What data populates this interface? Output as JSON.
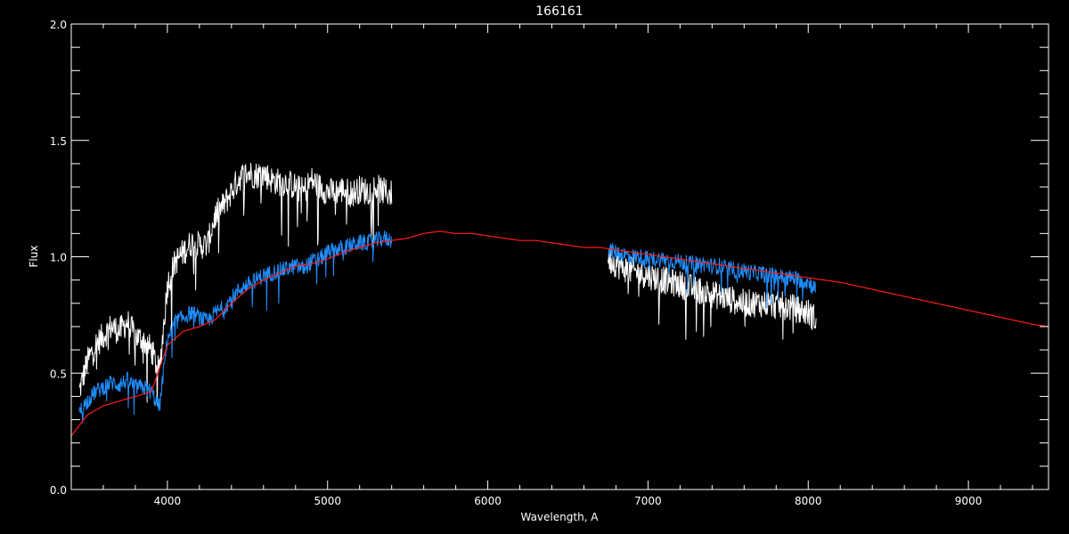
{
  "chart_data": {
    "type": "line",
    "title": "166161",
    "xlabel": "Wavelength, A",
    "ylabel": "Flux",
    "xlim": [
      3400,
      9500
    ],
    "ylim": [
      0.0,
      2.0
    ],
    "x_ticks": [
      4000,
      5000,
      6000,
      7000,
      8000,
      9000
    ],
    "x_tick_labels": [
      "4000",
      "5000",
      "6000",
      "7000",
      "8000",
      "9000"
    ],
    "y_ticks": [
      0.0,
      0.5,
      1.0,
      1.5,
      2.0
    ],
    "y_tick_labels": [
      "0.0",
      "0.5",
      "1.0",
      "1.5",
      "2.0"
    ],
    "grid": false,
    "background": "#000000",
    "series": [
      {
        "color": "#ffffff",
        "noise": 0.06,
        "segments": [
          {
            "x": [
              3450,
              3500,
              3550,
              3600,
              3650,
              3700,
              3750,
              3800,
              3850,
              3900,
              3950,
              4000,
              4050,
              4100,
              4150,
              4200,
              4250,
              4300,
              4350,
              4400,
              4450,
              4500,
              4550,
              4600,
              4650,
              4700,
              4750,
              4800,
              4850,
              4900,
              4950,
              5000,
              5050,
              5100,
              5150,
              5200,
              5250,
              5300,
              5350,
              5400
            ],
            "y": [
              0.42,
              0.55,
              0.62,
              0.66,
              0.7,
              0.68,
              0.72,
              0.66,
              0.64,
              0.6,
              0.5,
              0.88,
              0.98,
              1.02,
              1.06,
              1.05,
              1.05,
              1.18,
              1.22,
              1.28,
              1.34,
              1.36,
              1.35,
              1.36,
              1.33,
              1.32,
              1.32,
              1.3,
              1.28,
              1.33,
              1.3,
              1.28,
              1.28,
              1.29,
              1.27,
              1.29,
              1.28,
              1.3,
              1.28,
              1.27
            ]
          },
          {
            "x": [
              6750,
              6800,
              6850,
              6900,
              6950,
              7000,
              7050,
              7100,
              7150,
              7200,
              7250,
              7300,
              7350,
              7400,
              7450,
              7500,
              7550,
              7600,
              7650,
              7700,
              7750,
              7800,
              7850,
              7900,
              7950,
              8000,
              8050
            ],
            "y": [
              0.99,
              0.97,
              0.95,
              0.94,
              0.93,
              0.92,
              0.91,
              0.9,
              0.89,
              0.88,
              0.87,
              0.86,
              0.85,
              0.84,
              0.83,
              0.82,
              0.81,
              0.8,
              0.8,
              0.8,
              0.8,
              0.79,
              0.79,
              0.78,
              0.77,
              0.76,
              0.73
            ]
          }
        ]
      },
      {
        "color": "#1e8fff",
        "noise": 0.035,
        "segments": [
          {
            "x": [
              3450,
              3500,
              3550,
              3600,
              3650,
              3700,
              3750,
              3800,
              3850,
              3900,
              3950,
              4000,
              4050,
              4100,
              4150,
              4200,
              4250,
              4300,
              4350,
              4400,
              4450,
              4500,
              4550,
              4600,
              4650,
              4700,
              4750,
              4800,
              4850,
              4900,
              4950,
              5000,
              5050,
              5100,
              5150,
              5200,
              5250,
              5300,
              5350,
              5400
            ],
            "y": [
              0.33,
              0.38,
              0.42,
              0.44,
              0.46,
              0.45,
              0.47,
              0.44,
              0.44,
              0.42,
              0.35,
              0.65,
              0.72,
              0.74,
              0.76,
              0.74,
              0.72,
              0.76,
              0.78,
              0.82,
              0.86,
              0.88,
              0.9,
              0.92,
              0.93,
              0.94,
              0.95,
              0.96,
              0.95,
              0.98,
              0.99,
              1.02,
              1.03,
              1.04,
              1.05,
              1.06,
              1.06,
              1.07,
              1.08,
              1.07
            ]
          },
          {
            "x": [
              6750,
              6800,
              6850,
              6900,
              6950,
              7000,
              7050,
              7100,
              7150,
              7200,
              7250,
              7300,
              7350,
              7400,
              7450,
              7500,
              7550,
              7600,
              7650,
              7700,
              7750,
              7800,
              7850,
              7900,
              7950,
              8000,
              8050
            ],
            "y": [
              1.03,
              1.02,
              1.01,
              1.0,
              1.0,
              0.99,
              0.99,
              0.99,
              0.98,
              0.98,
              0.97,
              0.97,
              0.97,
              0.96,
              0.96,
              0.95,
              0.94,
              0.94,
              0.93,
              0.93,
              0.92,
              0.92,
              0.91,
              0.91,
              0.9,
              0.89,
              0.86
            ]
          },
          {
            "x": [
              3450,
              4000,
              4500,
              5000,
              5400
            ],
            "y": [
              0.0,
              0.0,
              0.0,
              0.0,
              0.0
            ]
          },
          {
            "x": [
              6750,
              7000,
              7500,
              8000,
              8050
            ],
            "y": [
              0.0,
              0.0,
              0.0,
              0.0,
              0.0
            ]
          }
        ]
      },
      {
        "color": "#ff1a1a",
        "noise": 0.0,
        "segments": [
          {
            "x": [
              3400,
              3500,
              3600,
              3700,
              3800,
              3900,
              4000,
              4100,
              4200,
              4300,
              4400,
              4500,
              4600,
              4700,
              4800,
              4900,
              5000,
              5100,
              5200,
              5300,
              5400,
              5500,
              5600,
              5700,
              5800,
              5900,
              6000,
              6100,
              6200,
              6300,
              6400,
              6500,
              6600,
              6700,
              6800,
              6900,
              7000,
              7200,
              7400,
              7600,
              7800,
              8000,
              8200,
              8400,
              8600,
              8800,
              9000,
              9200,
              9400,
              9500
            ],
            "y": [
              0.23,
              0.32,
              0.36,
              0.38,
              0.4,
              0.42,
              0.62,
              0.68,
              0.7,
              0.73,
              0.8,
              0.86,
              0.9,
              0.93,
              0.96,
              0.97,
              0.99,
              1.02,
              1.04,
              1.06,
              1.07,
              1.08,
              1.1,
              1.11,
              1.1,
              1.1,
              1.09,
              1.08,
              1.07,
              1.07,
              1.06,
              1.05,
              1.04,
              1.04,
              1.03,
              1.02,
              1.01,
              0.99,
              0.97,
              0.95,
              0.93,
              0.91,
              0.89,
              0.86,
              0.83,
              0.8,
              0.77,
              0.74,
              0.71,
              0.7
            ]
          }
        ]
      }
    ]
  }
}
